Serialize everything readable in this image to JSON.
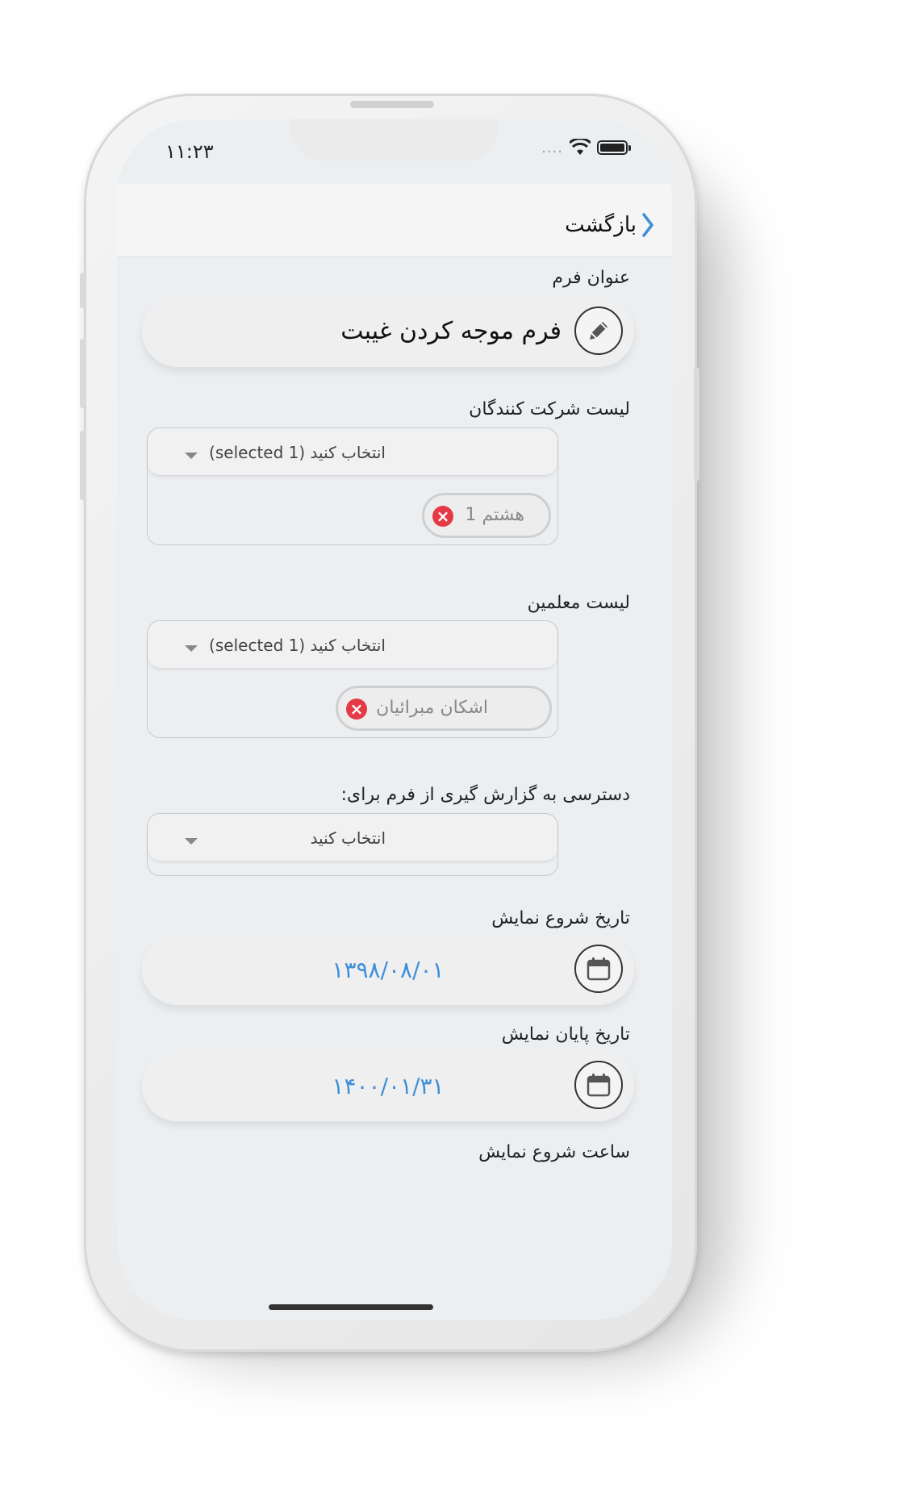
{
  "status_bar": {
    "time": "۱۱:۲۳",
    "signal": "...."
  },
  "nav": {
    "back_label": "بازگشت",
    "back_color": "#3f8fd8"
  },
  "form_title": {
    "label": "عنوان فرم",
    "value": "فرم موجه کردن غیبت",
    "icon": "pencil-icon"
  },
  "participants": {
    "label": "لیست شرکت کنندگان",
    "select_text": "انتخاب کنید (1 selected)",
    "chips": [
      {
        "text": "هشتم 1"
      }
    ]
  },
  "teachers": {
    "label": "لیست معلمین",
    "select_text": "انتخاب کنید (1 selected)",
    "chips": [
      {
        "text": "اشکان  مبرائیان"
      }
    ]
  },
  "report_access": {
    "label": "دسترسی به گزارش گیری از فرم برای:",
    "select_text": "انتخاب کنید"
  },
  "start_date": {
    "label": "تاریخ شروع نمایش",
    "value": "۱۳۹۸/۰۸/۰۱",
    "icon": "calendar-icon"
  },
  "end_date": {
    "label": "تاریخ پایان نمایش",
    "value": "۱۴۰۰/۰۱/۳۱",
    "icon": "calendar-icon"
  },
  "start_time": {
    "label": "ساعت شروع نمایش"
  },
  "colors": {
    "date_text": "#3f8fd8",
    "chip_remove": "#e53945"
  }
}
